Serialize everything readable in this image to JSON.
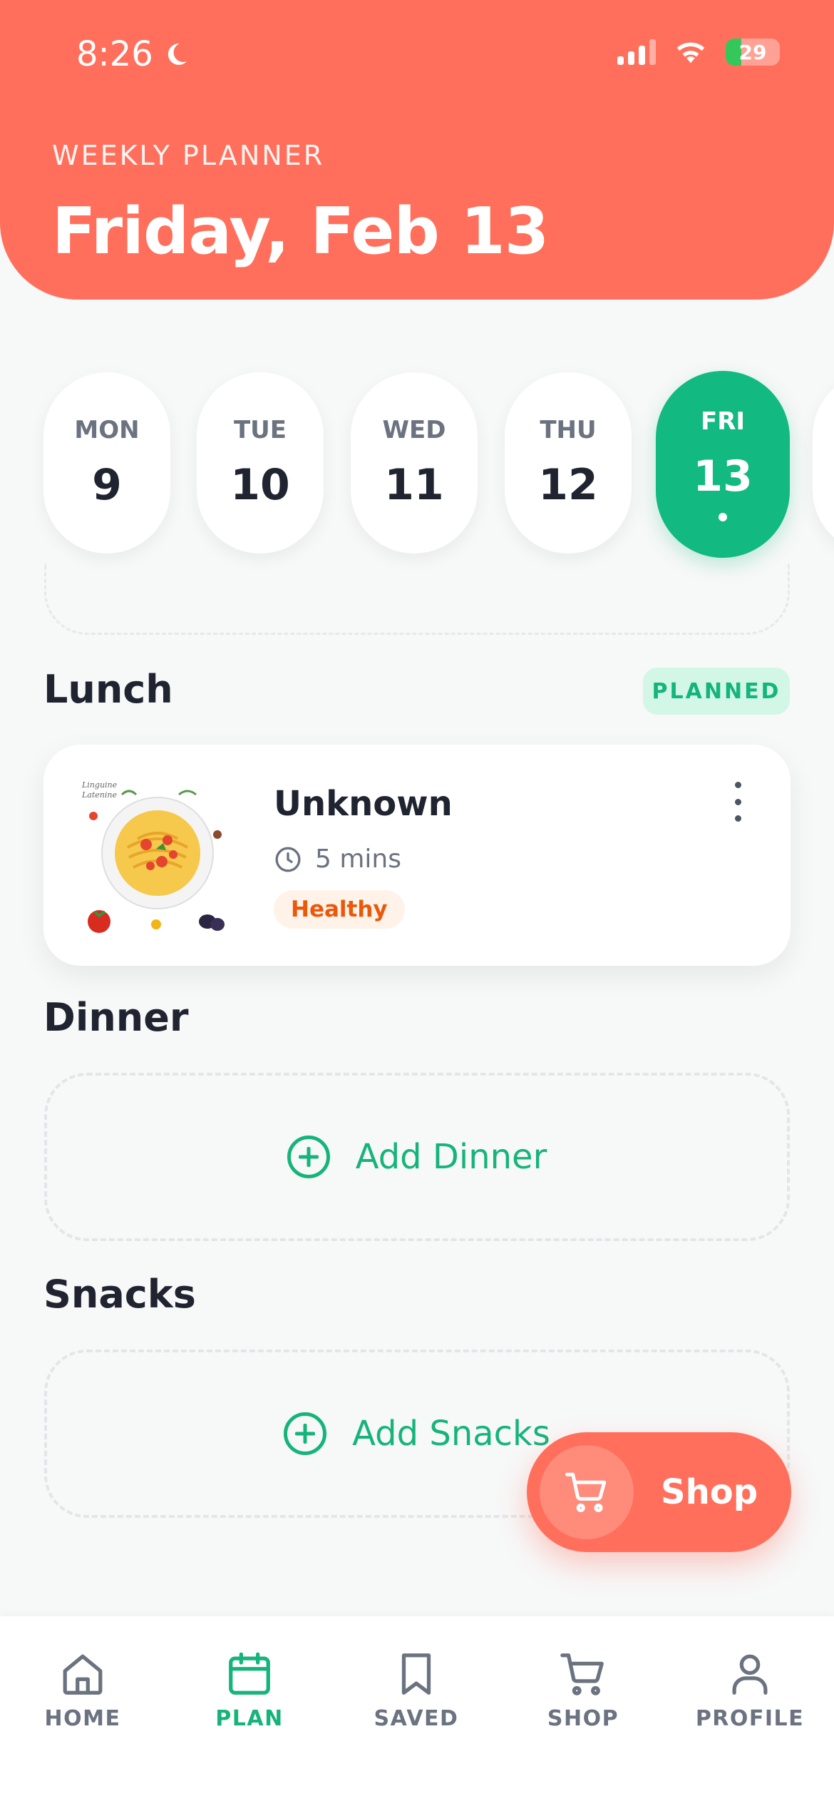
{
  "status_bar": {
    "time": "8:26",
    "battery": "29"
  },
  "header": {
    "eyebrow": "WEEKLY PLANNER",
    "title": "Friday, Feb 13"
  },
  "days": [
    {
      "name": "MON",
      "num": "9"
    },
    {
      "name": "TUE",
      "num": "10"
    },
    {
      "name": "WED",
      "num": "11"
    },
    {
      "name": "THU",
      "num": "12"
    },
    {
      "name": "FRI",
      "num": "13",
      "active": true
    }
  ],
  "lunch": {
    "title": "Lunch",
    "badge": "PLANNED",
    "meal": {
      "name": "Unknown",
      "time": "5 mins",
      "tag": "Healthy"
    }
  },
  "dinner": {
    "title": "Dinner",
    "add_label": "Add Dinner"
  },
  "snacks": {
    "title": "Snacks",
    "add_label": "Add Snacks"
  },
  "fab": {
    "label": "Shop"
  },
  "tabs": [
    {
      "label": "HOME",
      "icon": "home-icon"
    },
    {
      "label": "PLAN",
      "icon": "calendar-icon",
      "active": true
    },
    {
      "label": "SAVED",
      "icon": "bookmark-icon"
    },
    {
      "label": "SHOP",
      "icon": "cart-icon"
    },
    {
      "label": "PROFILE",
      "icon": "person-icon"
    }
  ],
  "colors": {
    "accent": "#ff6f5b",
    "green": "#12b981",
    "text": "#1f2430",
    "muted": "#6b7280"
  }
}
